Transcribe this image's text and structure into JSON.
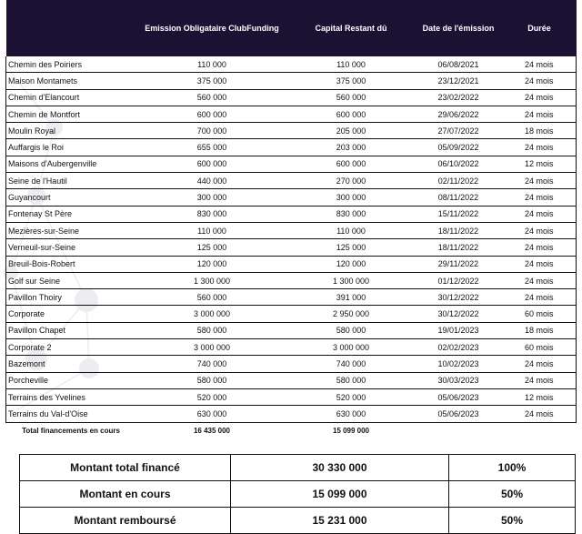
{
  "table": {
    "headers": [
      "",
      "Emission Obligataire ClubFunding",
      "Capital Restant dû",
      "Date de l'émission",
      "Durée"
    ],
    "rows": [
      [
        "Chemin des Poiriers",
        "110 000",
        "110 000",
        "06/08/2021",
        "24 mois"
      ],
      [
        "Maison Montamets",
        "375 000",
        "375 000",
        "23/12/2021",
        "24 mois"
      ],
      [
        "Chemin d'Elancourt",
        "560 000",
        "560 000",
        "23/02/2022",
        "24 mois"
      ],
      [
        "Chemin de Montfort",
        "600 000",
        "600 000",
        "29/06/2022",
        "24 mois"
      ],
      [
        "Moulin Royal",
        "700 000",
        "205 000",
        "27/07/2022",
        "18 mois"
      ],
      [
        "Auffargis le Roi",
        "655 000",
        "203 000",
        "05/09/2022",
        "24 mois"
      ],
      [
        "Maisons d'Aubergenville",
        "600 000",
        "600 000",
        "06/10/2022",
        "12 mois"
      ],
      [
        "Seine de l'Hautil",
        "440 000",
        "270 000",
        "02/11/2022",
        "24 mois"
      ],
      [
        "Guyancourt",
        "300 000",
        "300 000",
        "08/11/2022",
        "24 mois"
      ],
      [
        "Fontenay St Père",
        "830 000",
        "830 000",
        "15/11/2022",
        "24 mois"
      ],
      [
        "Mezières-sur-Seine",
        "110 000",
        "110 000",
        "18/11/2022",
        "24 mois"
      ],
      [
        "Verneuil-sur-Seine",
        "125 000",
        "125 000",
        "18/11/2022",
        "24 mois"
      ],
      [
        "Breuil-Bois-Robert",
        "120 000",
        "120 000",
        "29/11/2022",
        "24 mois"
      ],
      [
        "Golf sur Seine",
        "1 300 000",
        "1 300 000",
        "01/12/2022",
        "24 mois"
      ],
      [
        "Pavillon Thoiry",
        "560 000",
        "391 000",
        "30/12/2022",
        "24 mois"
      ],
      [
        "Corporate",
        "3 000 000",
        "2 950 000",
        "30/12/2022",
        "60 mois"
      ],
      [
        "Pavillon Chapet",
        "580 000",
        "580 000",
        "19/01/2023",
        "18 mois"
      ],
      [
        "Corporate 2",
        "3 000 000",
        "3 000 000",
        "02/02/2023",
        "60 mois"
      ],
      [
        "Bazemont",
        "740 000",
        "740 000",
        "10/02/2023",
        "24 mois"
      ],
      [
        "Porcheville",
        "580 000",
        "580 000",
        "30/03/2023",
        "24 mois"
      ],
      [
        "Terrains des Yvelines",
        "520 000",
        "520 000",
        "05/06/2023",
        "12 mois"
      ],
      [
        "Terrains du Val-d'Oise",
        "630 000",
        "630 000",
        "05/06/2023",
        "24 mois"
      ]
    ],
    "total": {
      "label": "Total financements en cours",
      "emission": "16 435 000",
      "capital": "15 099 000"
    }
  },
  "summary": [
    {
      "label": "Montant total financé",
      "amount": "30 330 000",
      "percent": "100%"
    },
    {
      "label": "Montant en cours",
      "amount": "15 099 000",
      "percent": "50%"
    },
    {
      "label": "Montant remboursé",
      "amount": "15 231 000",
      "percent": "50%"
    }
  ],
  "colors": {
    "header_bg": "#1a1133",
    "header_text": "#ffffff",
    "watermark": "#e9e9ee"
  }
}
